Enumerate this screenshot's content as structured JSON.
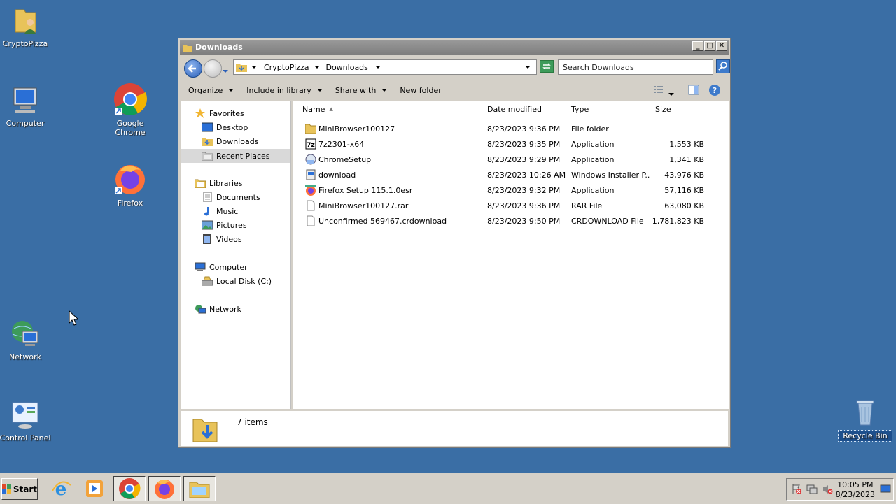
{
  "desktop": {
    "icons": [
      {
        "label": "CryptoPizza"
      },
      {
        "label": "Computer"
      },
      {
        "label": "Google Chrome"
      },
      {
        "label": "Firefox"
      },
      {
        "label": "Network"
      },
      {
        "label": "Control Panel"
      },
      {
        "label": "Recycle Bin"
      }
    ]
  },
  "window": {
    "title": "Downloads",
    "address": {
      "crumbs": [
        "CryptoPizza",
        "Downloads"
      ]
    },
    "search": {
      "placeholder": "Search Downloads"
    },
    "toolbar": {
      "organize": "Organize",
      "include_in_library": "Include in library",
      "share_with": "Share with",
      "new_folder": "New folder"
    },
    "nav": {
      "favorites": "Favorites",
      "desktop": "Desktop",
      "downloads": "Downloads",
      "recent_places": "Recent Places",
      "libraries": "Libraries",
      "documents": "Documents",
      "music": "Music",
      "pictures": "Pictures",
      "videos": "Videos",
      "computer": "Computer",
      "local_disk": "Local Disk (C:)",
      "network": "Network"
    },
    "columns": {
      "name": "Name",
      "date": "Date modified",
      "type": "Type",
      "size": "Size"
    },
    "files": [
      {
        "name": "MiniBrowser100127",
        "date": "8/23/2023 9:36 PM",
        "type": "File folder",
        "size": "",
        "icon": "folder-icon"
      },
      {
        "name": "7z2301-x64",
        "date": "8/23/2023 9:35 PM",
        "type": "Application",
        "size": "1,553 KB",
        "icon": "7zip-icon"
      },
      {
        "name": "ChromeSetup",
        "date": "8/23/2023 9:29 PM",
        "type": "Application",
        "size": "1,341 KB",
        "icon": "installer-icon"
      },
      {
        "name": "download",
        "date": "8/23/2023 10:26 AM",
        "type": "Windows Installer P...",
        "size": "43,976 KB",
        "icon": "msi-icon"
      },
      {
        "name": "Firefox Setup 115.1.0esr",
        "date": "8/23/2023 9:32 PM",
        "type": "Application",
        "size": "57,116 KB",
        "icon": "firefox-icon"
      },
      {
        "name": "MiniBrowser100127.rar",
        "date": "8/23/2023 9:36 PM",
        "type": "RAR File",
        "size": "63,080 KB",
        "icon": "file-icon"
      },
      {
        "name": "Unconfirmed 569467.crdownload",
        "date": "8/23/2023 9:50 PM",
        "type": "CRDOWNLOAD File",
        "size": "1,781,823 KB",
        "icon": "file-icon"
      }
    ],
    "status": "7 items"
  },
  "taskbar": {
    "start": "Start",
    "clock": {
      "time": "10:05 PM",
      "date": "8/23/2023"
    }
  },
  "colors": {
    "desktop": "#3a6ea5",
    "taskbar": "#d4d0c8",
    "selection": "#d9d9d9"
  }
}
